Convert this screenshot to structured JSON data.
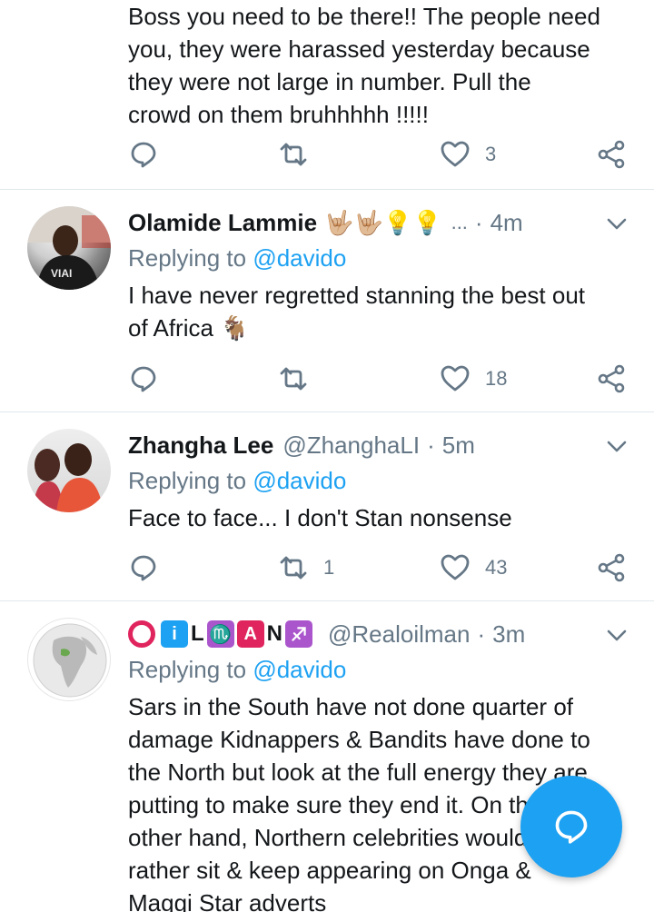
{
  "tweets": [
    {
      "text_lines": [
        "Boss you need to be there!! The people need",
        "you, they were harassed yesterday because",
        "they were not large in number. Pull the",
        "crowd on them bruhhhhh !!!!!"
      ],
      "actions": {
        "reply": "",
        "retweet": "",
        "like": "3"
      }
    },
    {
      "name": "Olamide Lammie",
      "name_emojis": "🤟🏼🤟🏼💡💡",
      "ellipsis": "...",
      "dot": "·",
      "time": "4m",
      "reply_prefix": "Replying to",
      "reply_mention": "@davido",
      "text_lines": [
        "I have never regretted stanning the best out",
        "of Africa 🐐"
      ],
      "actions": {
        "reply": "",
        "retweet": "",
        "like": "18"
      }
    },
    {
      "name": "Zhangha Lee",
      "handle": "@ZhanghaLI",
      "dot": "·",
      "time": "5m",
      "reply_prefix": "Replying to",
      "reply_mention": "@davido",
      "text_lines": [
        "Face to face... I don't Stan nonsense"
      ],
      "actions": {
        "reply": "",
        "retweet": "1",
        "like": "43"
      }
    },
    {
      "name_letters": {
        "i": "i",
        "l": "L",
        "m": "♏",
        "a": "A",
        "n": "N"
      },
      "handle": "@Realoilman",
      "dot": "·",
      "time": "3m",
      "reply_prefix": "Replying to",
      "reply_mention": "@davido",
      "text_lines": [
        "Sars in the South have not done quarter of",
        "damage Kidnappers & Bandits have done to",
        "the North but look at the full energy they are",
        "putting to make sure they end it. On the",
        "other hand, Northern celebrities would",
        "rather sit & keep appearing on Onga &",
        "Maggi Star adverts"
      ]
    }
  ],
  "colors": {
    "accent": "#1da1f2",
    "muted": "#657786",
    "text": "#14171a",
    "divider": "#e1e8ed"
  },
  "icons": {
    "reply": "reply-icon",
    "retweet": "retweet-icon",
    "like": "heart-icon",
    "share": "share-icon",
    "more": "chevron-down-icon",
    "compose": "compose-reply-icon"
  }
}
